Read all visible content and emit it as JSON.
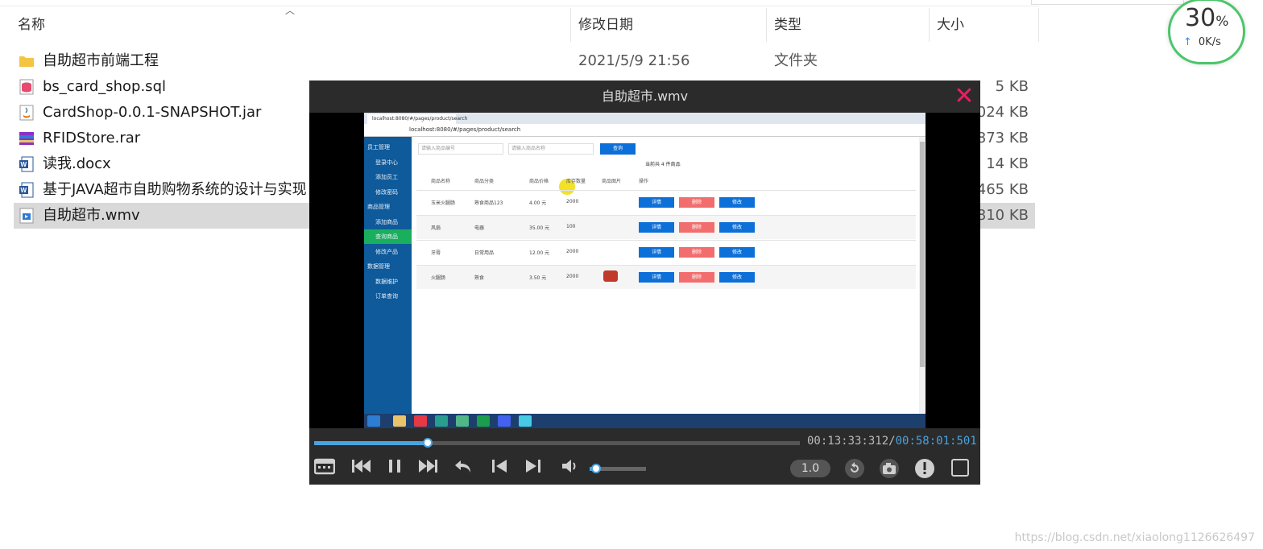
{
  "explorer": {
    "columns": {
      "name": "名称",
      "date": "修改日期",
      "type": "类型",
      "size": "大小"
    },
    "files": [
      {
        "name": "自助超市前端工程",
        "date": "2021/5/9 21:56",
        "type": "文件夹",
        "size": "",
        "icon": "folder-icon"
      },
      {
        "name": "bs_card_shop.sql",
        "date": "",
        "type": "",
        "size": "5 KB",
        "icon": "database-file-icon"
      },
      {
        "name": "CardShop-0.0.1-SNAPSHOT.jar",
        "date": "",
        "type": "",
        "size": "024 KB",
        "icon": "java-jar-icon"
      },
      {
        "name": "RFIDStore.rar",
        "date": "",
        "type": "",
        "size": "873 KB",
        "icon": "archive-icon"
      },
      {
        "name": "读我.docx",
        "date": "",
        "type": "",
        "size": "14 KB",
        "icon": "word-doc-icon"
      },
      {
        "name": "基于JAVA超市自助购物系统的设计与实现",
        "date": "",
        "type": "",
        "size": "465 KB",
        "icon": "word-doc-icon"
      },
      {
        "name": "自助超市.wmv",
        "date": "",
        "type": "",
        "size": "810 KB",
        "icon": "video-file-icon"
      }
    ]
  },
  "speed_widget": {
    "percent": "30",
    "percent_sign": "%",
    "rate": "0K/s",
    "arrow": "↑"
  },
  "player": {
    "title": "自助超市.wmv",
    "current_time": "00:13:33:312",
    "separator": "/",
    "duration": "00:58:01:501",
    "progress_fraction": 0.2335,
    "volume_fraction": 0.12,
    "playback_speed": "1.0",
    "accent_color": "#4aa3df",
    "close_color": "#e91e63"
  },
  "video_frame": {
    "browser_tab": "localhost:8080/#/pages/product/search",
    "url": "localhost:8080/#/pages/product/search",
    "sidebar": [
      {
        "label": "员工管理",
        "active": false,
        "indent": false
      },
      {
        "label": "登录中心",
        "active": false,
        "indent": true
      },
      {
        "label": "添加员工",
        "active": false,
        "indent": true
      },
      {
        "label": "修改密码",
        "active": false,
        "indent": true
      },
      {
        "label": "商品管理",
        "active": false,
        "indent": false
      },
      {
        "label": "添加商品",
        "active": false,
        "indent": true
      },
      {
        "label": "查询商品",
        "active": true,
        "indent": true
      },
      {
        "label": "修改产品",
        "active": false,
        "indent": true
      },
      {
        "label": "数据管理",
        "active": false,
        "indent": false
      },
      {
        "label": "数据维护",
        "active": false,
        "indent": true
      },
      {
        "label": "订单查询",
        "active": false,
        "indent": true
      }
    ],
    "search_placeholder_1": "请输入商品编号",
    "search_placeholder_2": "请输入商品名称",
    "query_button": "查询",
    "summary": "当前共 4 件商品",
    "table_headers": [
      "商品名称",
      "商品分类",
      "商品价格",
      "库存数量",
      "商品图片",
      "操作"
    ],
    "rows": [
      {
        "name": "玉米火腿肠",
        "category": "熟食商品123",
        "price": "4.00 元",
        "stock": "2000"
      },
      {
        "name": "风扇",
        "category": "电器",
        "price": "35.00 元",
        "stock": "100"
      },
      {
        "name": "牙膏",
        "category": "日常用品",
        "price": "12.00 元",
        "stock": "2000"
      },
      {
        "name": "火腿肠",
        "category": "熟食",
        "price": "3.50 元",
        "stock": "2000"
      }
    ],
    "actions": {
      "detail": "详情",
      "delete": "删除",
      "edit": "修改"
    }
  },
  "watermark": "https://blog.csdn.net/xiaolong1126626497"
}
